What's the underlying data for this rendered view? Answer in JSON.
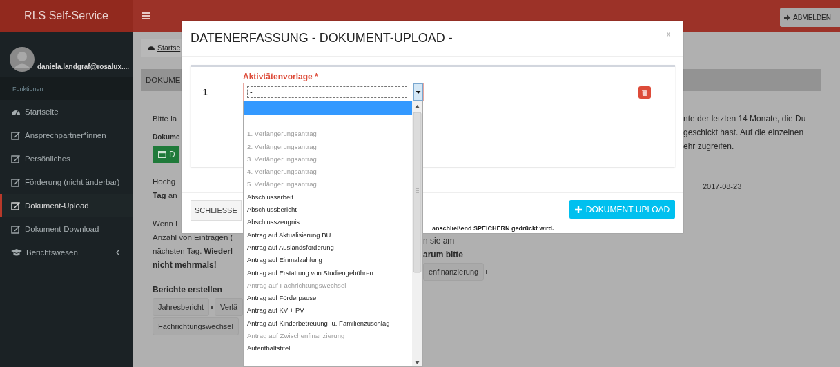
{
  "topbar": {
    "brand": "RLS Self-Service",
    "logout": "ABMELDEN"
  },
  "sidebar": {
    "user": "daniela.landgraf@rosalux....",
    "section": "Funktionen",
    "items": [
      {
        "label": "Startseite",
        "kind": "dashboard",
        "selected": false,
        "submenu": false
      },
      {
        "label": "Ansprechpartner*innen",
        "kind": "edit",
        "selected": false,
        "submenu": false
      },
      {
        "label": "Persönliches",
        "kind": "edit",
        "selected": false,
        "submenu": false
      },
      {
        "label": "Förderung (nicht änderbar)",
        "kind": "edit",
        "selected": false,
        "submenu": false
      },
      {
        "label": "Dokument-Upload",
        "kind": "edit",
        "selected": true,
        "submenu": false
      },
      {
        "label": "Dokument-Download",
        "kind": "edit",
        "selected": false,
        "submenu": false
      },
      {
        "label": "Berichtswesen",
        "kind": "reports",
        "selected": false,
        "submenu": true
      }
    ]
  },
  "breadcrumb": "Startse",
  "panel": {
    "title": "DOKUME",
    "intro": "Bitte la",
    "documents_label": "Dokume",
    "documents_button": "D",
    "uploaded": [
      "Hochg",
      "**Tag** an"
    ],
    "notice": [
      {
        "text": "Wenn I",
        "bold": false
      },
      {
        "text": "Anzahl von Einträgen (",
        "bold": false
      },
      {
        "text": "nächsten Tag. **Wiederl**",
        "bold": false
      },
      {
        "text": "nicht mehrmals!",
        "bold": true
      }
    ],
    "notice_right": [
      {
        "text": "n sie am",
        "bold": false
      },
      {
        "text": "arum bitte",
        "bold": true
      }
    ],
    "info_right": [
      "nte der letzten 14 Monate, die Du",
      "geschickt hast. Auf die einzelnen",
      "ehr zugreifen."
    ],
    "date": "2017-08-23",
    "reports": {
      "title": "Berichte erstellen",
      "row_1": [
        {
          "label": "Jahresbericht",
          "caret": true
        },
        {
          "label": "Verlä",
          "caret": false
        }
      ],
      "row_1_right": [
        {
          "label": "enfinanzierung",
          "caret": true
        }
      ],
      "row_2": [
        {
          "label": "Fachrichtungswechsel",
          "caret": false
        }
      ]
    }
  },
  "modal": {
    "title": "DATENERFASSUNG - DOKUMENT-UPLOAD -",
    "close": "x",
    "rows": [
      {
        "number": "1",
        "field_label": "Aktivtätenvorlage *",
        "value": "-"
      }
    ],
    "close_button": "SCHLIESSE",
    "upload_button": "DOKUMENT-UPLOAD",
    "note": "anschließend SPEICHERN gedrückt wird."
  },
  "dropdown": {
    "options": [
      {
        "label": "-",
        "selected": true,
        "disabled": false
      },
      {
        "selected": false
      },
      {
        "label": "1. Verlängerungsantrag",
        "selected": false,
        "disabled": true
      },
      {
        "label": "2. Verlängerungsantrag",
        "selected": false,
        "disabled": true
      },
      {
        "label": "3. Verlängerungsantrag",
        "selected": false,
        "disabled": true
      },
      {
        "label": "4. Verlängerungsantrag",
        "selected": false,
        "disabled": true
      },
      {
        "label": "5. Verlängerungsantrag",
        "selected": false,
        "disabled": true
      },
      {
        "label": "Abschlussarbeit",
        "selected": false,
        "disabled": false
      },
      {
        "label": "Abschlussbericht",
        "selected": false,
        "disabled": false
      },
      {
        "label": "Abschlusszeugnis",
        "selected": false,
        "disabled": false
      },
      {
        "label": "Antrag auf Aktualisierung BU",
        "selected": false,
        "disabled": false
      },
      {
        "label": "Antrag auf Auslandsförderung",
        "selected": false,
        "disabled": false
      },
      {
        "label": "Antrag auf Einmalzahlung",
        "selected": false,
        "disabled": false
      },
      {
        "label": "Antrag auf Erstattung von Studiengebühren",
        "selected": false,
        "disabled": false
      },
      {
        "label": "Antrag auf Fachrichtungswechsel",
        "selected": false,
        "disabled": true
      },
      {
        "label": "Antrag auf Förderpause",
        "selected": false,
        "disabled": false
      },
      {
        "label": "Antrag auf KV + PV",
        "selected": false,
        "disabled": false
      },
      {
        "label": "Antrag auf Kinderbetreuung- u. Familienzuschlag",
        "selected": false,
        "disabled": false
      },
      {
        "label": "Antrag auf Zwischenfinanzierung",
        "selected": false,
        "disabled": true
      },
      {
        "label": "Aufenthaltstitel",
        "selected": false,
        "disabled": false
      }
    ]
  }
}
